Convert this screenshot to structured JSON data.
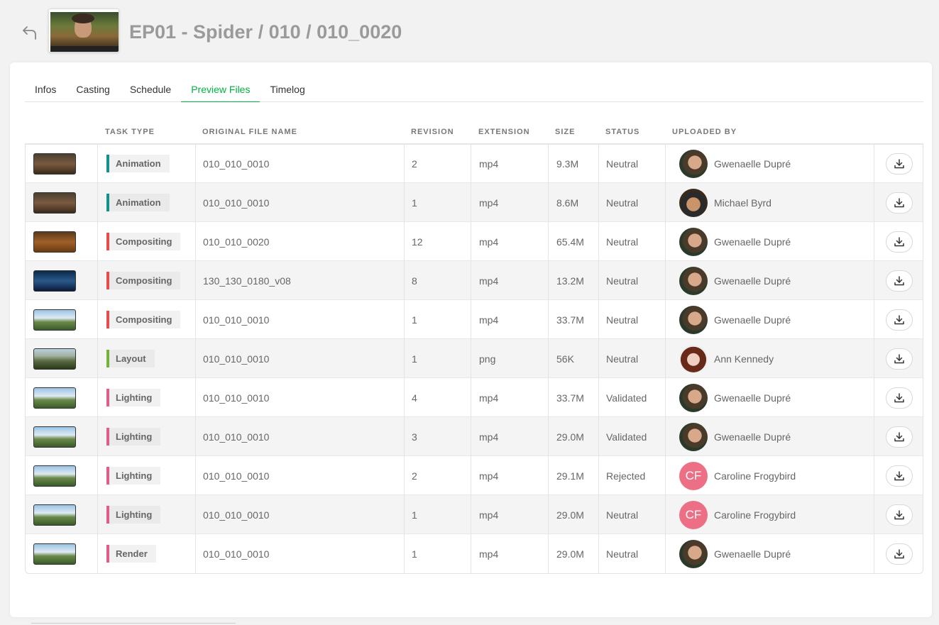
{
  "header": {
    "title": "EP01 - Spider / 010 / 010_0020",
    "back_icon": "back-arrow-icon"
  },
  "tabs": [
    {
      "label": "Infos",
      "active": false
    },
    {
      "label": "Casting",
      "active": false
    },
    {
      "label": "Schedule",
      "active": false
    },
    {
      "label": "Preview Files",
      "active": true
    },
    {
      "label": "Timelog",
      "active": false
    }
  ],
  "colors": {
    "accent": "#00b242",
    "animation": "#13918a",
    "compositing": "#e84b4b",
    "layout": "#75b23c",
    "lighting": "#e25c8b",
    "render": "#e25c8b",
    "avatar_cf": "#ec6f85"
  },
  "table": {
    "headers": {
      "task_type": "TASK TYPE",
      "original_file_name": "ORIGINAL FILE NAME",
      "revision": "REVISION",
      "extension": "EXTENSION",
      "size": "SIZE",
      "status": "STATUS",
      "uploaded_by": "UPLOADED BY"
    },
    "rows": [
      {
        "task_type": "Animation",
        "task_key": "animation",
        "thumb": "anim",
        "file": "010_010_0010",
        "revision": "2",
        "extension": "mp4",
        "size": "9.3M",
        "status": "Neutral",
        "user": "Gwenaelle Dupré",
        "avatar": "photo-gd",
        "initials": ""
      },
      {
        "task_type": "Animation",
        "task_key": "animation",
        "thumb": "anim",
        "file": "010_010_0010",
        "revision": "1",
        "extension": "mp4",
        "size": "8.6M",
        "status": "Neutral",
        "user": "Michael Byrd",
        "avatar": "photo-mb",
        "initials": ""
      },
      {
        "task_type": "Compositing",
        "task_key": "compositing",
        "thumb": "comp1",
        "file": "010_010_0020",
        "revision": "12",
        "extension": "mp4",
        "size": "65.4M",
        "status": "Neutral",
        "user": "Gwenaelle Dupré",
        "avatar": "photo-gd",
        "initials": ""
      },
      {
        "task_type": "Compositing",
        "task_key": "compositing",
        "thumb": "comp2",
        "file": "130_130_0180_v08",
        "revision": "8",
        "extension": "mp4",
        "size": "13.2M",
        "status": "Neutral",
        "user": "Gwenaelle Dupré",
        "avatar": "photo-gd",
        "initials": ""
      },
      {
        "task_type": "Compositing",
        "task_key": "compositing",
        "thumb": "sky",
        "file": "010_010_0010",
        "revision": "1",
        "extension": "mp4",
        "size": "33.7M",
        "status": "Neutral",
        "user": "Gwenaelle Dupré",
        "avatar": "photo-gd",
        "initials": ""
      },
      {
        "task_type": "Layout",
        "task_key": "layout",
        "thumb": "layout",
        "file": "010_010_0010",
        "revision": "1",
        "extension": "png",
        "size": "56K",
        "status": "Neutral",
        "user": "Ann Kennedy",
        "avatar": "photo-ak",
        "initials": ""
      },
      {
        "task_type": "Lighting",
        "task_key": "lighting",
        "thumb": "sky",
        "file": "010_010_0010",
        "revision": "4",
        "extension": "mp4",
        "size": "33.7M",
        "status": "Validated",
        "user": "Gwenaelle Dupré",
        "avatar": "photo-gd",
        "initials": ""
      },
      {
        "task_type": "Lighting",
        "task_key": "lighting",
        "thumb": "sky",
        "file": "010_010_0010",
        "revision": "3",
        "extension": "mp4",
        "size": "29.0M",
        "status": "Validated",
        "user": "Gwenaelle Dupré",
        "avatar": "photo-gd",
        "initials": ""
      },
      {
        "task_type": "Lighting",
        "task_key": "lighting",
        "thumb": "sky",
        "file": "010_010_0010",
        "revision": "2",
        "extension": "mp4",
        "size": "29.1M",
        "status": "Rejected",
        "user": "Caroline Frogybird",
        "avatar": "initials",
        "initials": "CF"
      },
      {
        "task_type": "Lighting",
        "task_key": "lighting",
        "thumb": "sky",
        "file": "010_010_0010",
        "revision": "1",
        "extension": "mp4",
        "size": "29.0M",
        "status": "Neutral",
        "user": "Caroline Frogybird",
        "avatar": "initials",
        "initials": "CF"
      },
      {
        "task_type": "Render",
        "task_key": "render",
        "thumb": "sky",
        "file": "010_010_0010",
        "revision": "1",
        "extension": "mp4",
        "size": "29.0M",
        "status": "Neutral",
        "user": "Gwenaelle Dupré",
        "avatar": "photo-gd",
        "initials": ""
      }
    ]
  }
}
